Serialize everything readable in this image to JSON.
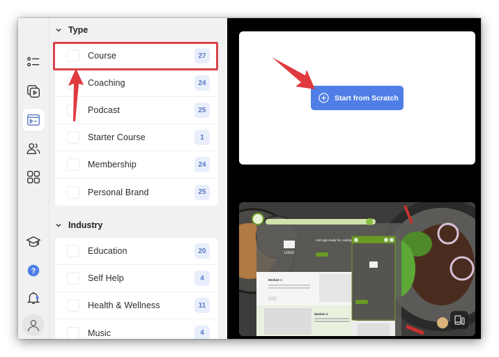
{
  "rail": {
    "items": [
      {
        "name": "list-icon",
        "active": false
      },
      {
        "name": "video-library-icon",
        "active": false
      },
      {
        "name": "templates-icon",
        "active": true
      },
      {
        "name": "users-icon",
        "active": false
      },
      {
        "name": "apps-grid-icon",
        "active": false
      },
      {
        "name": "graduation-cap-icon",
        "active": false
      },
      {
        "name": "help-icon",
        "active": false
      },
      {
        "name": "bell-icon",
        "active": false
      },
      {
        "name": "avatar-icon",
        "active": false
      }
    ]
  },
  "filters": {
    "type": {
      "title": "Type",
      "items": [
        {
          "label": "Course",
          "count": "27"
        },
        {
          "label": "Coaching",
          "count": "24"
        },
        {
          "label": "Podcast",
          "count": "25"
        },
        {
          "label": "Starter Course",
          "count": "1"
        },
        {
          "label": "Membership",
          "count": "24"
        },
        {
          "label": "Personal Brand",
          "count": "25"
        }
      ]
    },
    "industry": {
      "title": "Industry",
      "items": [
        {
          "label": "Education",
          "count": "20"
        },
        {
          "label": "Self Help",
          "count": "4"
        },
        {
          "label": "Health & Wellness",
          "count": "11"
        },
        {
          "label": "Music",
          "count": "4"
        }
      ]
    }
  },
  "main": {
    "scratch_button": "Start from Scratch",
    "template_preview": {
      "logo_text": "LOGO",
      "module_1": "Module 1",
      "module_2": "Module 2",
      "hero_text": "Let's get ready for cooking"
    }
  },
  "colors": {
    "accent": "#4f7fe6",
    "highlight": "#d9434a",
    "count_bg": "#e8eefb",
    "count_text": "#5b7ac4",
    "template_green": "#6a9a24"
  }
}
